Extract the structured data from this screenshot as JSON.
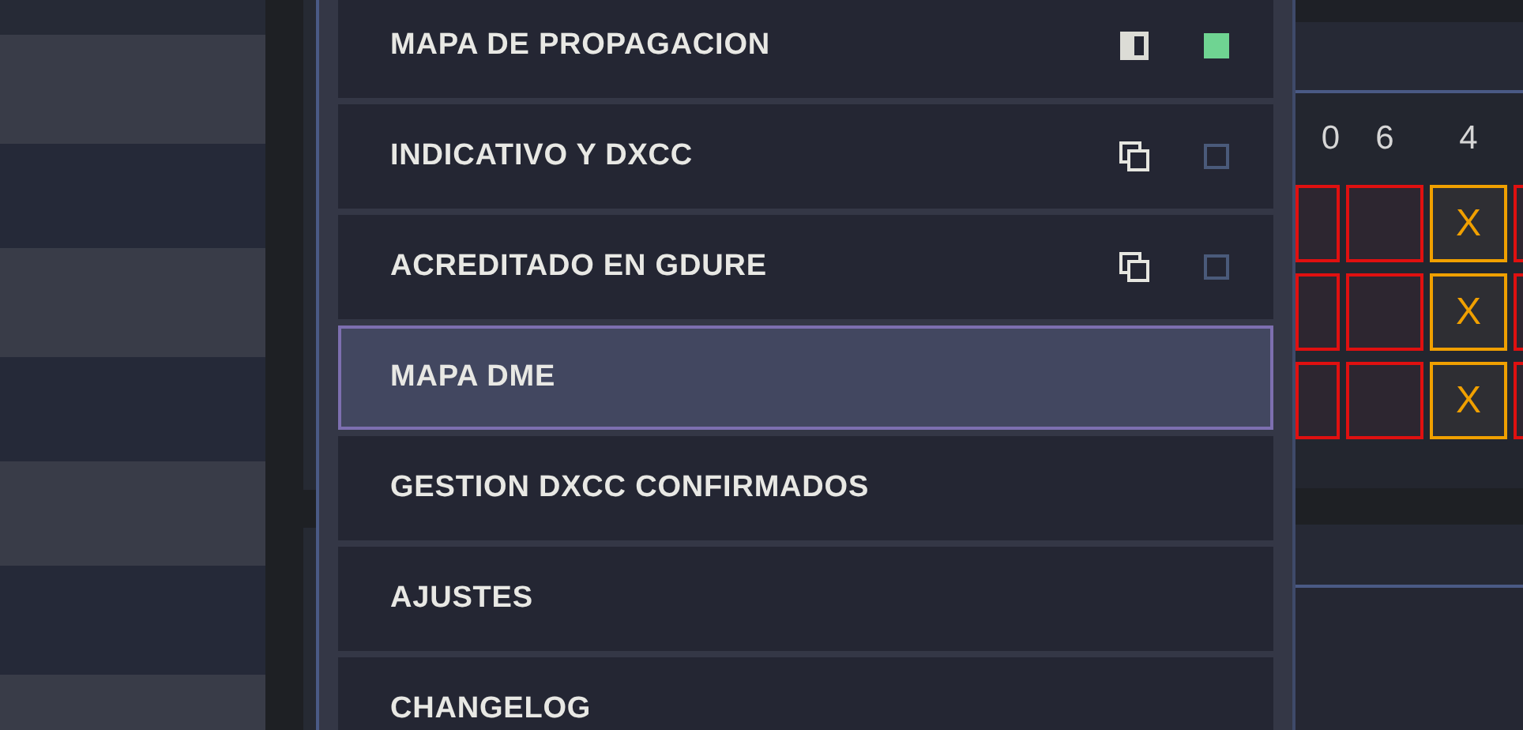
{
  "menu": {
    "items": [
      {
        "label": "MAPA DE PROPAGACION",
        "selected": false,
        "kind": "half",
        "toggle": {
          "checked": true
        }
      },
      {
        "label": "INDICATIVO Y DXCC",
        "selected": false,
        "kind": "overlap",
        "toggle": {
          "checked": false
        }
      },
      {
        "label": "ACREDITADO EN GDURE",
        "selected": false,
        "kind": "overlap",
        "toggle": {
          "checked": false
        }
      },
      {
        "label": "MAPA DME",
        "selected": true
      },
      {
        "label": "GESTION DXCC CONFIRMADOS",
        "selected": false
      },
      {
        "label": "AJUSTES",
        "selected": false
      },
      {
        "label": "CHANGELOG",
        "selected": false
      }
    ]
  },
  "grid": {
    "columns": [
      "0",
      "6",
      "4"
    ],
    "rows": [
      {
        "cells": [
          {
            "kind": "empty"
          },
          {
            "kind": "empty"
          },
          {
            "kind": "marked",
            "text": "X"
          },
          {
            "kind": "empty"
          }
        ]
      },
      {
        "cells": [
          {
            "kind": "empty"
          },
          {
            "kind": "empty"
          },
          {
            "kind": "marked",
            "text": "X"
          },
          {
            "kind": "empty"
          }
        ]
      },
      {
        "cells": [
          {
            "kind": "empty"
          },
          {
            "kind": "empty"
          },
          {
            "kind": "marked",
            "text": "X"
          },
          {
            "kind": "empty"
          }
        ]
      }
    ]
  }
}
